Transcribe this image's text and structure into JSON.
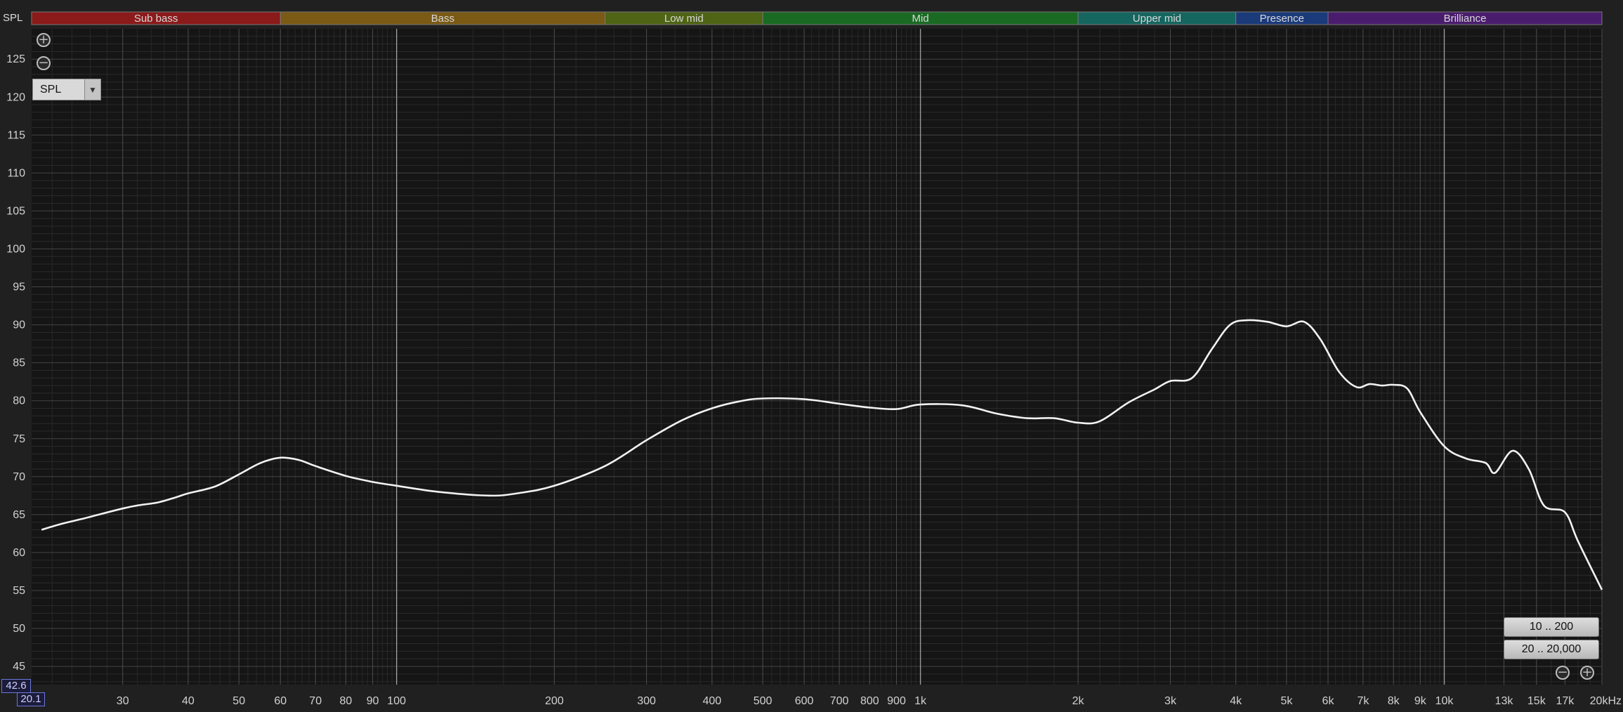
{
  "chart_data": {
    "type": "line",
    "ylabel": "SPL",
    "xlabel": "",
    "x_scale": "log",
    "xlim": [
      20.1,
      20000
    ],
    "ylim": [
      42.6,
      129
    ],
    "grid": true,
    "y_ticks": [
      45,
      50,
      55,
      60,
      65,
      70,
      75,
      80,
      85,
      90,
      95,
      100,
      105,
      110,
      115,
      120,
      125
    ],
    "x_ticks": [
      {
        "value": 30,
        "label": "30"
      },
      {
        "value": 40,
        "label": "40"
      },
      {
        "value": 50,
        "label": "50"
      },
      {
        "value": 60,
        "label": "60"
      },
      {
        "value": 70,
        "label": "70"
      },
      {
        "value": 80,
        "label": "80"
      },
      {
        "value": 90,
        "label": "90"
      },
      {
        "value": 100,
        "label": "100"
      },
      {
        "value": 200,
        "label": "200"
      },
      {
        "value": 300,
        "label": "300"
      },
      {
        "value": 400,
        "label": "400"
      },
      {
        "value": 500,
        "label": "500"
      },
      {
        "value": 600,
        "label": "600"
      },
      {
        "value": 700,
        "label": "700"
      },
      {
        "value": 800,
        "label": "800"
      },
      {
        "value": 900,
        "label": "900"
      },
      {
        "value": 1000,
        "label": "1k"
      },
      {
        "value": 2000,
        "label": "2k"
      },
      {
        "value": 3000,
        "label": "3k"
      },
      {
        "value": 4000,
        "label": "4k"
      },
      {
        "value": 5000,
        "label": "5k"
      },
      {
        "value": 6000,
        "label": "6k"
      },
      {
        "value": 7000,
        "label": "7k"
      },
      {
        "value": 8000,
        "label": "8k"
      },
      {
        "value": 9000,
        "label": "9k"
      },
      {
        "value": 10000,
        "label": "10k"
      },
      {
        "value": 13000,
        "label": "13k"
      },
      {
        "value": 15000,
        "label": "15k"
      },
      {
        "value": 17000,
        "label": "17k"
      },
      {
        "value": 20000,
        "label": "20kHz"
      }
    ],
    "bands": [
      {
        "name": "Sub bass",
        "from": 20.1,
        "to": 60,
        "color": "#8b1a1a"
      },
      {
        "name": "Bass",
        "from": 60,
        "to": 250,
        "color": "#7a5a14"
      },
      {
        "name": "Low mid",
        "from": 250,
        "to": 500,
        "color": "#4f6414"
      },
      {
        "name": "Mid",
        "from": 500,
        "to": 2000,
        "color": "#1a6a24"
      },
      {
        "name": "Upper mid",
        "from": 2000,
        "to": 4000,
        "color": "#166660"
      },
      {
        "name": "Presence",
        "from": 4000,
        "to": 6000,
        "color": "#1a3a7a"
      },
      {
        "name": "Brilliance",
        "from": 6000,
        "to": 20000,
        "color": "#4a1c6e"
      }
    ],
    "series": [
      {
        "color": "#f2f2f2",
        "x": [
          21,
          23,
          25,
          27,
          30,
          32,
          35,
          38,
          40,
          45,
          50,
          55,
          60,
          65,
          70,
          80,
          90,
          100,
          120,
          150,
          170,
          200,
          250,
          300,
          350,
          400,
          450,
          500,
          600,
          700,
          800,
          900,
          1000,
          1200,
          1400,
          1600,
          1800,
          2000,
          2200,
          2500,
          2800,
          3000,
          3300,
          3600,
          3900,
          4200,
          4600,
          5000,
          5400,
          5800,
          6300,
          6800,
          7200,
          7600,
          8000,
          8500,
          9000,
          10000,
          11000,
          12000,
          12500,
          13500,
          14500,
          15500,
          17000,
          18000,
          20000
        ],
        "y": [
          63.0,
          63.8,
          64.4,
          65.0,
          65.8,
          66.2,
          66.6,
          67.3,
          67.8,
          68.7,
          70.3,
          71.8,
          72.5,
          72.2,
          71.4,
          70.1,
          69.3,
          68.8,
          68.0,
          67.5,
          67.8,
          68.8,
          71.4,
          74.8,
          77.4,
          79.0,
          79.9,
          80.3,
          80.2,
          79.6,
          79.1,
          78.9,
          79.5,
          79.4,
          78.3,
          77.7,
          77.7,
          77.1,
          77.3,
          79.8,
          81.5,
          82.6,
          83.0,
          86.8,
          90.0,
          90.6,
          90.4,
          89.8,
          90.4,
          88.1,
          83.8,
          81.8,
          82.2,
          82.0,
          82.1,
          81.6,
          78.5,
          74.0,
          72.4,
          71.8,
          70.5,
          73.4,
          71.0,
          66.2,
          65.3,
          61.5,
          55.1
        ]
      }
    ]
  },
  "controls": {
    "zoom_in_icon": "plus-circle-icon",
    "zoom_out_icon": "minus-circle-icon",
    "measurement_select": "SPL",
    "range_low_label": "10 .. 200",
    "range_full_label": "20 .. 20,000",
    "y_min_readout": "42.6",
    "x_min_readout": "20.1"
  }
}
